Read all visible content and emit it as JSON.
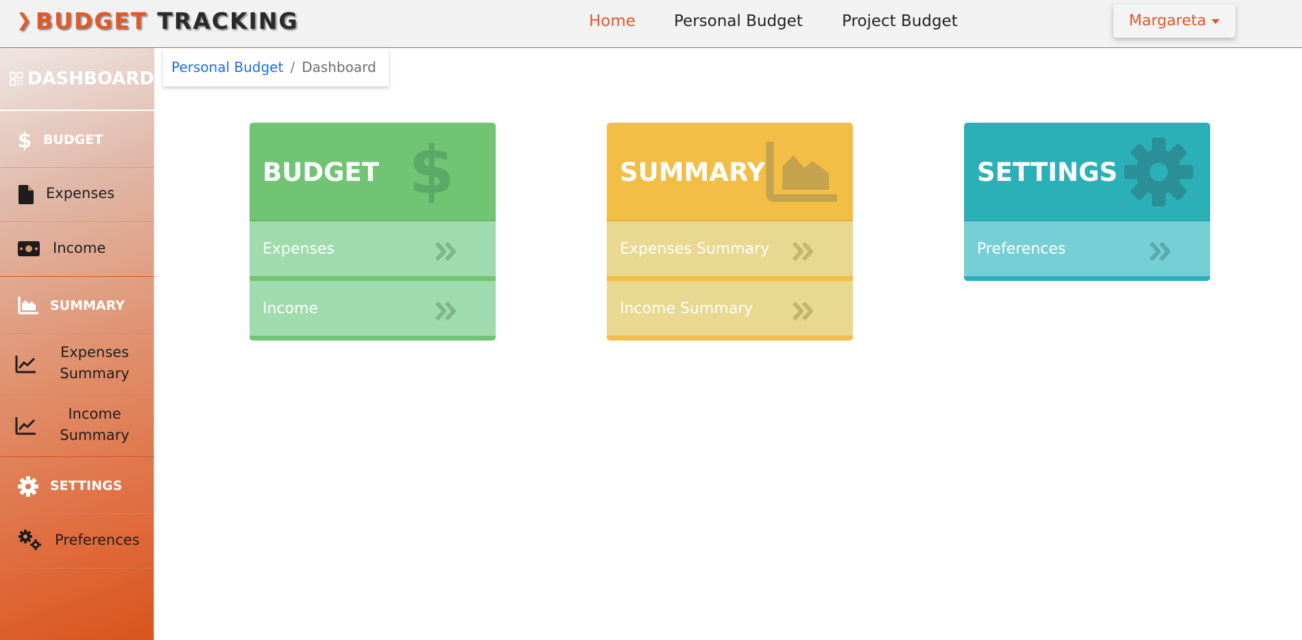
{
  "brand": {
    "part1": "BUDGET",
    "part2": "TRACKING",
    "accent": "#e0592a"
  },
  "nav": {
    "home": "Home",
    "personal": "Personal Budget",
    "project": "Project Budget"
  },
  "user": {
    "name": "Margareta"
  },
  "sidebar": {
    "dashboard": "DASHBOARD",
    "budget": {
      "heading": "BUDGET",
      "expenses": "Expenses",
      "income": "Income"
    },
    "summary": {
      "heading": "SUMMARY",
      "expenses_line1": "Expenses",
      "expenses_line2": "Summary",
      "income_line1": "Income",
      "income_line2": "Summary"
    },
    "settings": {
      "heading": "SETTINGS",
      "preferences": "Preferences"
    }
  },
  "breadcrumb": {
    "link": "Personal Budget",
    "separator": "/",
    "current": "Dashboard"
  },
  "cards": {
    "budget": {
      "title": "BUDGET",
      "icon": "dollar-icon",
      "items": [
        "Expenses",
        "Income"
      ],
      "color": "#70c474"
    },
    "summary": {
      "title": "SUMMARY",
      "icon": "area-chart-icon",
      "items": [
        "Expenses Summary",
        "Income Summary"
      ],
      "color": "#f2be45"
    },
    "settings": {
      "title": "SETTINGS",
      "icon": "gear-icon",
      "items": [
        "Preferences"
      ],
      "color": "#2cb0b8"
    }
  }
}
